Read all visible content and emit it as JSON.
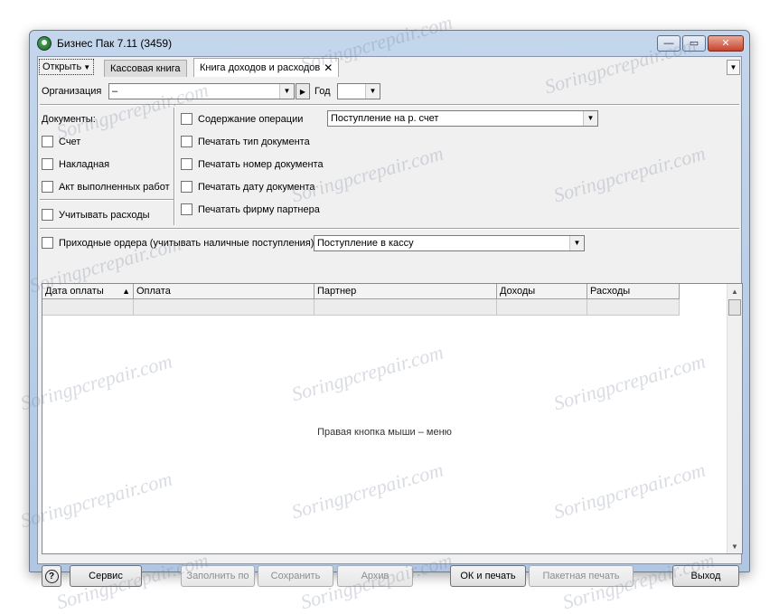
{
  "window": {
    "title": "Бизнес Пак 7.11 (3459)",
    "controls": {
      "minimize": "—",
      "maximize": "▭",
      "close": "✕"
    }
  },
  "tabs": {
    "open_label": "Открыть",
    "items": [
      {
        "label": "Кассовая книга",
        "active": false
      },
      {
        "label": "Книга доходов и расходов",
        "active": true
      }
    ],
    "close_glyph": "✕"
  },
  "filters": {
    "organization_label": "Организация",
    "organization_value": "–",
    "year_label": "Год",
    "year_value": ""
  },
  "documents": {
    "heading": "Документы:",
    "items": [
      "Счет",
      "Накладная",
      "Акт выполненных работ"
    ],
    "expenses_label": "Учитывать расходы"
  },
  "options": {
    "operation_label": "Содержание операции",
    "operation_value": "Поступление на р. счет",
    "items": [
      "Печатать тип документа",
      "Печатать номер документа",
      "Печатать дату документа",
      "Печатать фирму партнера"
    ]
  },
  "cash": {
    "label": "Приходные ордера (учитывать наличные поступления)",
    "value": "Поступление в кассу"
  },
  "grid": {
    "columns": [
      "Дата оплаты",
      "Оплата",
      "Партнер",
      "Доходы",
      "Расходы"
    ],
    "sort_glyph": "▲",
    "empty_text": "Правая кнопка мыши – меню"
  },
  "buttons": {
    "help": "?",
    "service": "Сервис",
    "fill": "Заполнить по",
    "save": "Сохранить",
    "archive": "Архив",
    "ok_print": "ОК и печать",
    "batch_print": "Пакетная печать",
    "exit": "Выход"
  },
  "watermark": "Soringpcrepair.com"
}
